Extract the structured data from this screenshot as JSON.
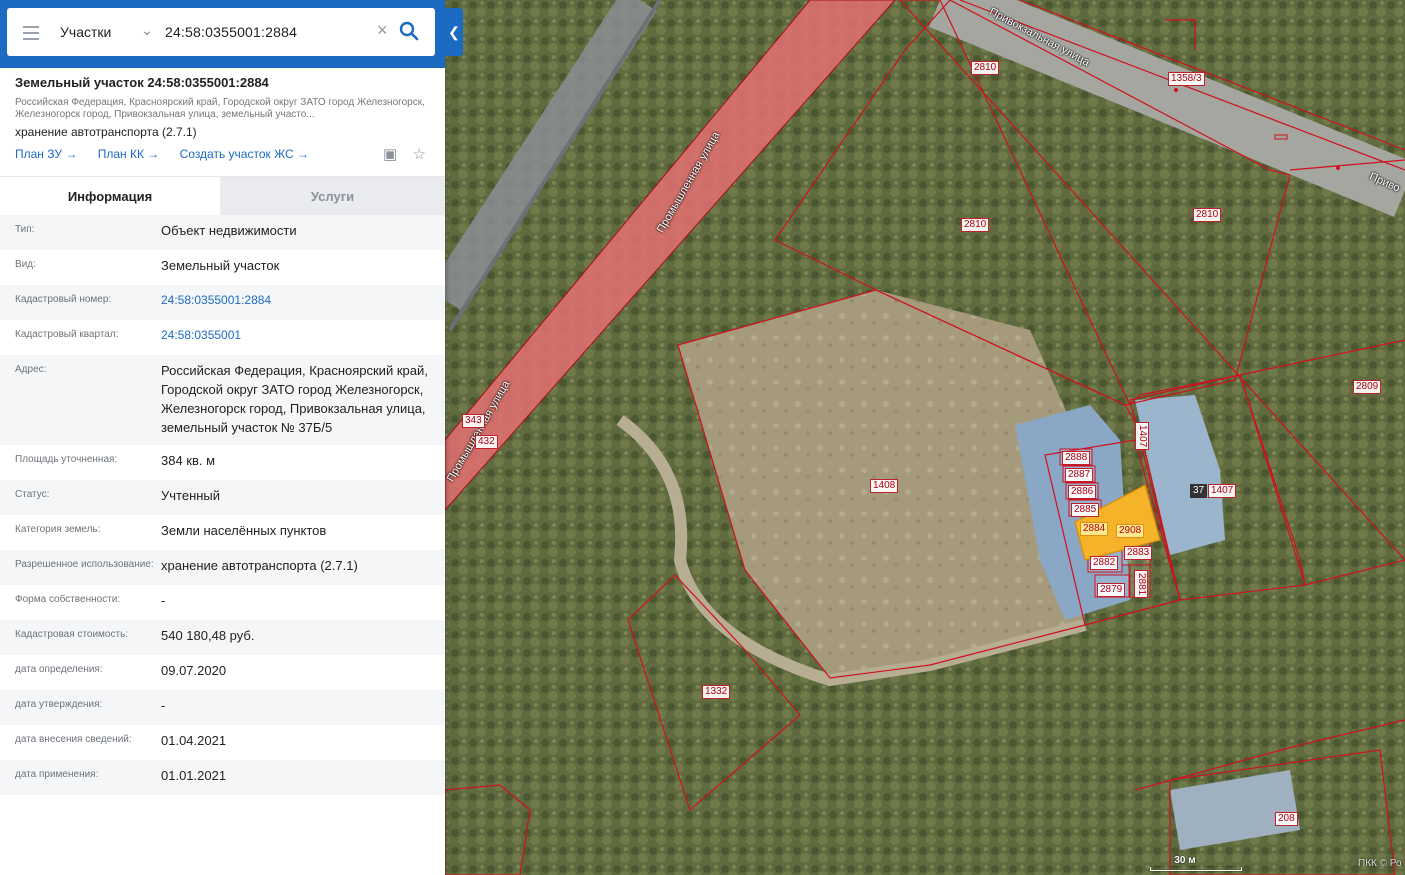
{
  "search": {
    "layer": "Участки",
    "query": "24:58:0355001:2884"
  },
  "object": {
    "title": "Земельный участок 24:58:0355001:2884",
    "address_short": "Российская Федерация, Красноярский край, Городской округ ЗАТО город Железногорск, Железногорск город, Привокзальная улица, земельный участо...",
    "permitted_use": "хранение автотранспорта (2.7.1)",
    "links": [
      "План ЗУ →",
      "План КК →",
      "Создать участок ЖС →"
    ]
  },
  "tabs": [
    "Информация",
    "Услуги"
  ],
  "info_rows": [
    {
      "label": "Тип:",
      "value": "Объект недвижимости"
    },
    {
      "label": "Вид:",
      "value": "Земельный участок"
    },
    {
      "label": "Кадастровый номер:",
      "value": "24:58:0355001:2884"
    },
    {
      "label": "Кадастровый квартал:",
      "value": "24:58:0355001"
    },
    {
      "label": "Адрес:",
      "value": "Российская Федерация, Красноярский край, Городской округ ЗАТО город Железногорск, Железногорск город, Привокзальная улица, земельный участок № 37Б/5"
    },
    {
      "label": "Площадь уточненная:",
      "value": "384 кв. м"
    },
    {
      "label": "Статус:",
      "value": "Учтенный"
    },
    {
      "label": "Категория земель:",
      "value": "Земли населённых пунктов"
    },
    {
      "label": "Разрешенное использование:",
      "value": "хранение автотранспорта (2.7.1)"
    },
    {
      "label": "Форма собственности:",
      "value": "-"
    },
    {
      "label": "Кадастровая стоимость:",
      "value": "540 180,48 руб."
    },
    {
      "label": "дата определения:",
      "value": "09.07.2020"
    },
    {
      "label": "дата утверждения:",
      "value": "-"
    },
    {
      "label": "дата внесения сведений:",
      "value": "01.04.2021"
    },
    {
      "label": "дата применения:",
      "value": "01.01.2021"
    }
  ],
  "map": {
    "parcels": [
      "2810",
      "2810",
      "2810",
      "1358/3",
      "1408",
      "1407",
      "1407",
      "2809",
      "1332",
      "208",
      "2888",
      "2887",
      "2886",
      "2885",
      "2884",
      "2908",
      "2883",
      "2882",
      "2881",
      "2879",
      "343",
      "432",
      "37"
    ],
    "streets": [
      "Промышленная улица",
      "Промышленная улица",
      "Привокзальная улица",
      "Приво"
    ],
    "scale": "30 м",
    "copyright": "ПКК © Ро"
  },
  "colors": {
    "accent": "#1b6bc2",
    "parcel_border": "#d0101e",
    "selected": "#f5b32a"
  }
}
